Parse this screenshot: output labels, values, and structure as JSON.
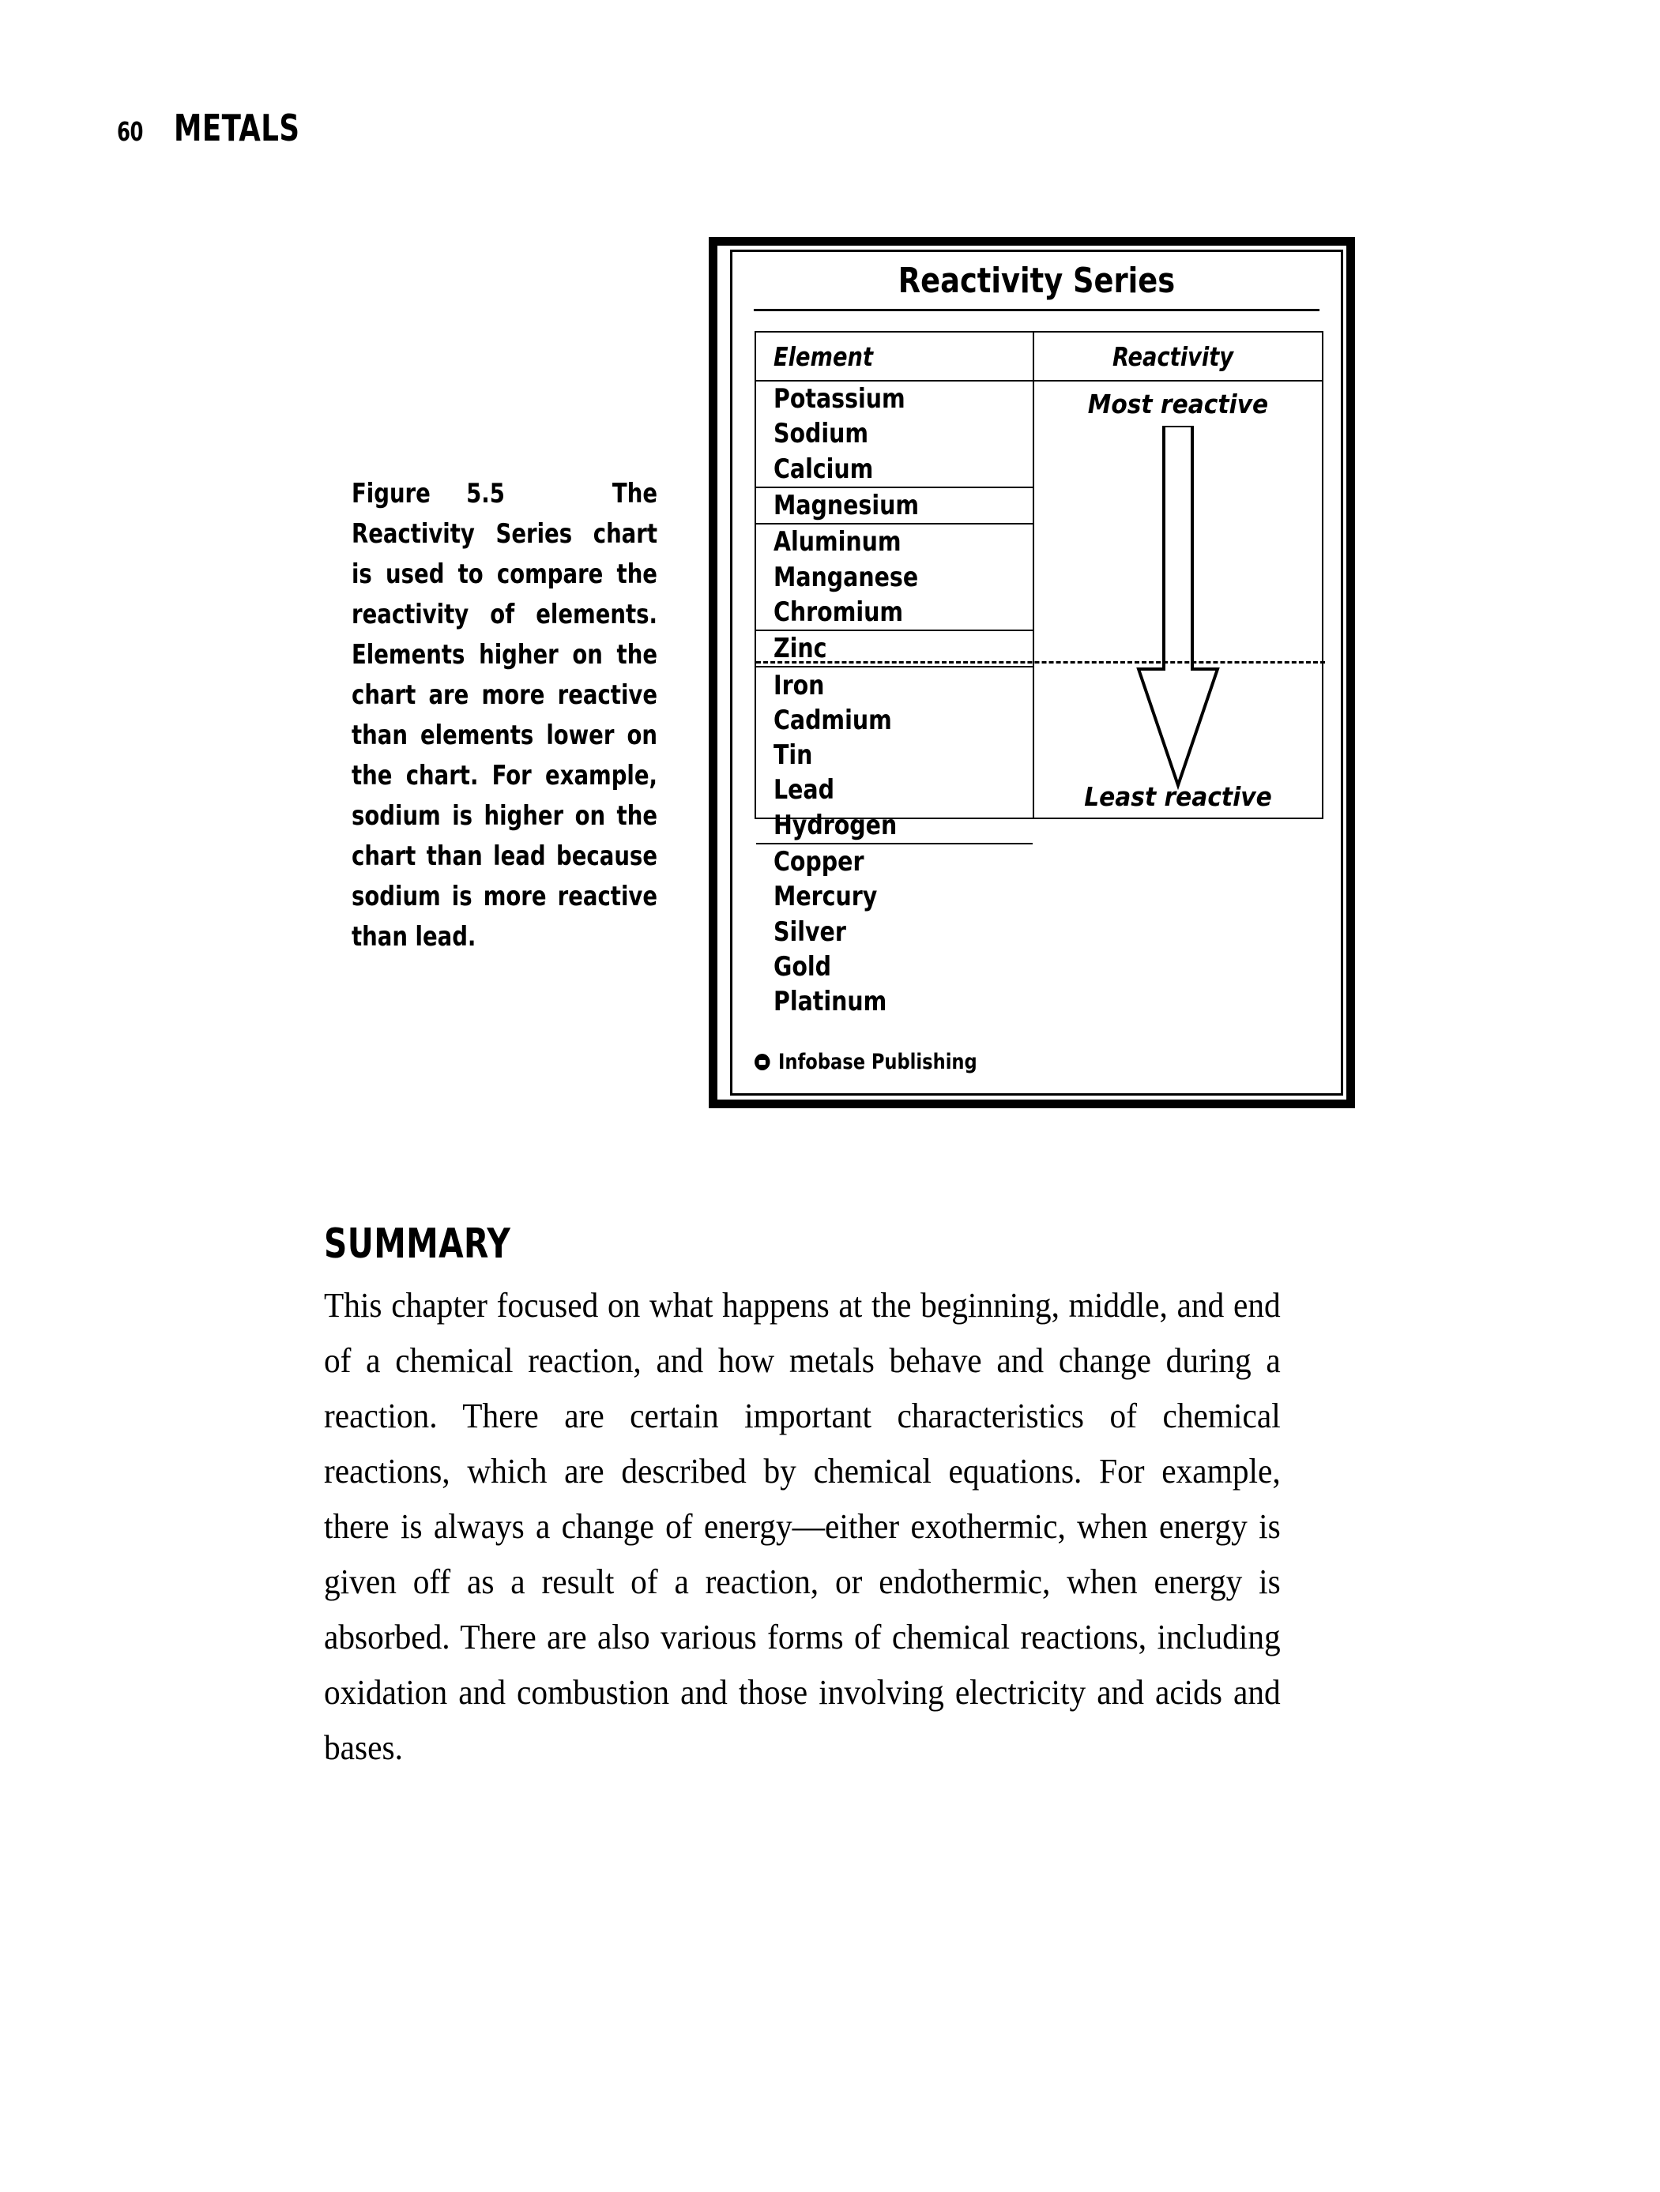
{
  "running_head": {
    "page_number": "60",
    "chapter_title": "METALS"
  },
  "figure": {
    "caption_lead": "Figure 5.5",
    "caption_text": "The Reactivity Series chart is used to compare the reactivity of elements. Elements higher on the chart are more reactive than elements lower on the chart. For example, sodium is higher on the chart than lead because sodium is more reactive than lead.",
    "title": "Reactivity Series",
    "credit": "Infobase Publishing",
    "copyright_symbol": "copyright-icon"
  },
  "chart_data": {
    "type": "table",
    "title": "Reactivity Series",
    "columns": [
      "Element",
      "Reactivity"
    ],
    "annotations": {
      "top_label": "Most reactive",
      "bottom_label": "Least reactive",
      "arrow": "downward-arrow",
      "dashed_line_after": "Hydrogen"
    },
    "groups": [
      {
        "elements": [
          "Potassium",
          "Sodium",
          "Calcium"
        ]
      },
      {
        "elements": [
          "Magnesium"
        ]
      },
      {
        "elements": [
          "Aluminum",
          "Manganese",
          "Chromium"
        ]
      },
      {
        "elements": [
          "Zinc"
        ]
      },
      {
        "elements": [
          "Iron",
          "Cadmium",
          "Tin",
          "Lead",
          "Hydrogen"
        ]
      },
      {
        "elements": [
          "Copper",
          "Mercury",
          "Silver",
          "Gold",
          "Platinum"
        ]
      }
    ],
    "elements_ordered": [
      "Potassium",
      "Sodium",
      "Calcium",
      "Magnesium",
      "Aluminum",
      "Manganese",
      "Chromium",
      "Zinc",
      "Iron",
      "Cadmium",
      "Tin",
      "Lead",
      "Hydrogen",
      "Copper",
      "Mercury",
      "Silver",
      "Gold",
      "Platinum"
    ]
  },
  "summary": {
    "heading": "SUMMARY",
    "paragraph": "This chapter focused on what happens at the beginning, middle, and end of a chemical reaction, and how metals behave and change during a reaction. There are certain important characteristics of chemical reactions, which are described by chemical equations. For example, there is always a change of energy—either exothermic, when energy is given off as a result of a reaction, or endothermic, when energy is absorbed. There are also various forms of chemical reactions, including oxidation and combustion and those involving electricity and acids and bases."
  }
}
